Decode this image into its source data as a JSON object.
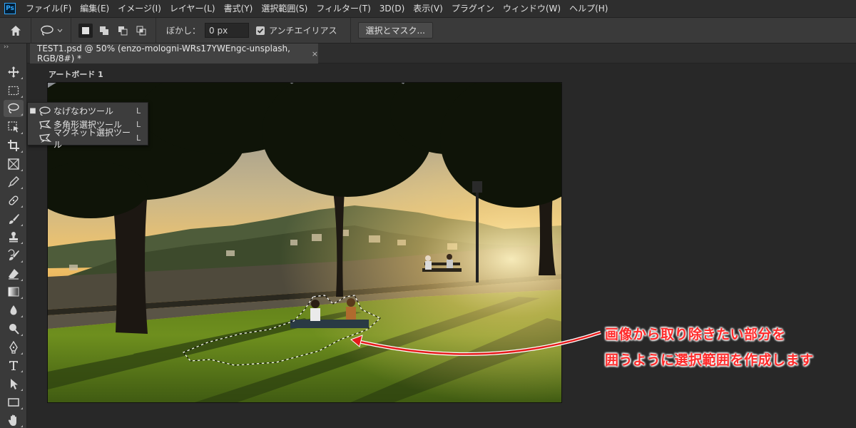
{
  "app": {
    "logo_text": "Ps"
  },
  "menu": {
    "items": [
      "ファイル(F)",
      "編集(E)",
      "イメージ(I)",
      "レイヤー(L)",
      "書式(Y)",
      "選択範囲(S)",
      "フィルター(T)",
      "3D(D)",
      "表示(V)",
      "プラグイン",
      "ウィンドウ(W)",
      "ヘルプ(H)"
    ]
  },
  "options": {
    "feather_label": "ぼかし：",
    "feather_value": "0 px",
    "antialias_label": "アンチエイリアス",
    "antialias_checked": true,
    "mask_button": "選択とマスク..."
  },
  "document": {
    "tab_title": "TEST1.psd @ 50% (enzo-mologni-WRs17YWEngc-unsplash, RGB/8#) *",
    "close_symbol": "×",
    "artboard_label": "アートボード 1"
  },
  "flyout": {
    "items": [
      {
        "label": "なげなわツール",
        "key": "L",
        "icon": "lasso-icon",
        "selected": true
      },
      {
        "label": "多角形選択ツール",
        "key": "L",
        "icon": "polygonal-lasso-icon",
        "selected": false
      },
      {
        "label": "マグネット選択ツール",
        "key": "L",
        "icon": "magnetic-lasso-icon",
        "selected": false
      }
    ],
    "selected_marker": "■"
  },
  "annotation": {
    "line1": "画像から取り除きたい部分を",
    "line2": "囲うように選択範囲を作成します",
    "color": "#ff2a2a"
  },
  "tools": [
    "move-icon",
    "marquee-icon",
    "lasso-icon",
    "object-select-icon",
    "crop-icon",
    "frame-icon",
    "eyedropper-icon",
    "healing-icon",
    "brush-icon",
    "stamp-icon",
    "history-brush-icon",
    "eraser-icon",
    "gradient-icon",
    "blur-icon",
    "dodge-icon",
    "pen-icon",
    "type-icon",
    "path-select-icon",
    "rectangle-icon",
    "hand-icon"
  ]
}
